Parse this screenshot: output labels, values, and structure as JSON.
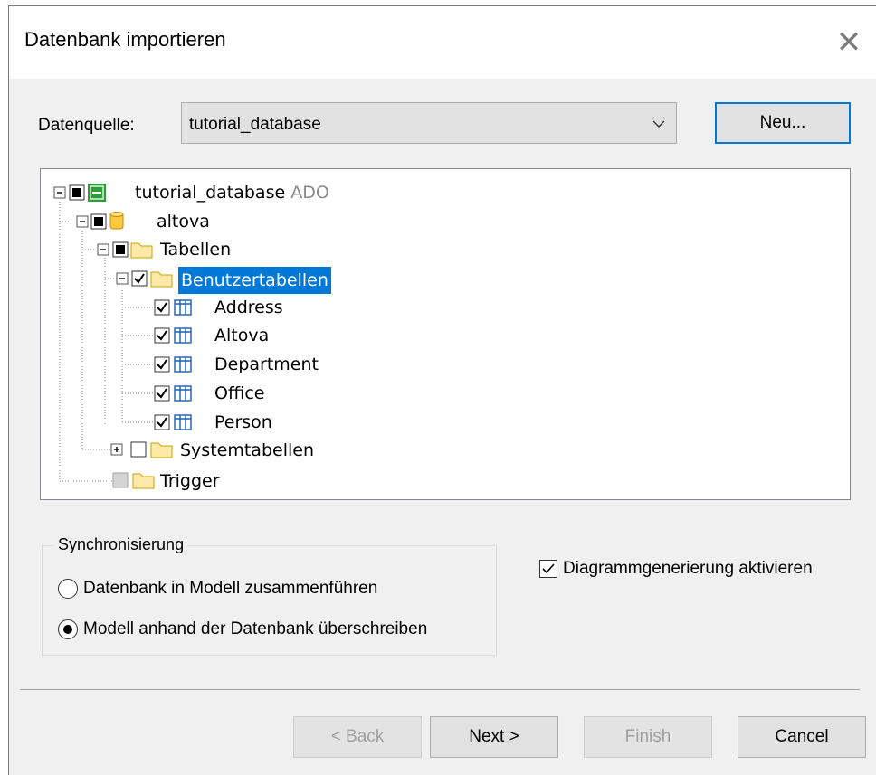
{
  "window": {
    "title": "Datenbank importieren"
  },
  "datasource": {
    "label": "Datenquelle:",
    "selected": "tutorial_database",
    "new_button": "Neu..."
  },
  "tree": {
    "root": {
      "label": "tutorial_database",
      "sub": "ADO"
    },
    "schema": "altova",
    "tables_folder": "Tabellen",
    "user_tables": "Benutzertabellen",
    "tables": [
      "Address",
      "Altova",
      "Department",
      "Office",
      "Person"
    ],
    "system_tables": "Systemtabellen",
    "trigger": "Trigger"
  },
  "sync": {
    "title": "Synchronisierung",
    "option_merge": "Datenbank in Modell zusammenführen",
    "option_overwrite": "Modell anhand der Datenbank überschreiben",
    "selected": "overwrite"
  },
  "diagram": {
    "label": "Diagrammgenerierung aktivieren",
    "checked": true
  },
  "buttons": {
    "back": "< Back",
    "next": "Next >",
    "finish": "Finish",
    "cancel": "Cancel"
  },
  "colors": {
    "accent": "#0078d7",
    "db_icon": "#ffc83d",
    "table_icon": "#1a5fb4"
  }
}
